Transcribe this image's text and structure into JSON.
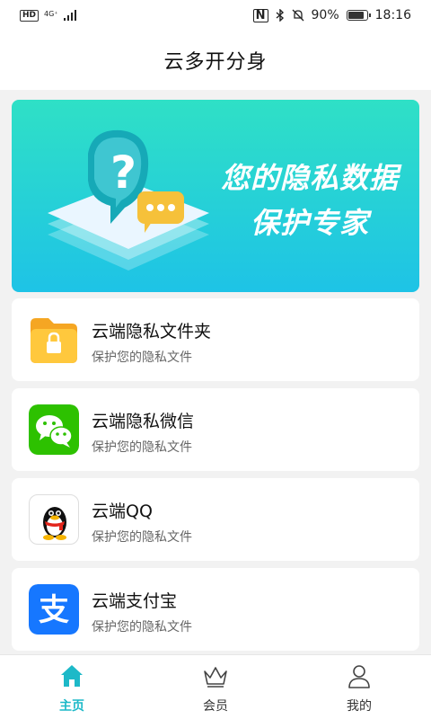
{
  "status_bar": {
    "hd": "HD",
    "network": "4G⁺",
    "nfc": "N",
    "battery_percent": "90%",
    "battery_level": 0.9,
    "time": "18:16"
  },
  "header": {
    "title": "云多开分身"
  },
  "banner": {
    "line1": "您的隐私数据",
    "line2": "保护专家",
    "gradient_top": "#2fe0c6",
    "gradient_bottom": "#1ec3e6"
  },
  "apps": [
    {
      "title": "云端隐私文件夹",
      "subtitle": "保护您的隐私文件",
      "icon": "folder-lock-icon"
    },
    {
      "title": "云端隐私微信",
      "subtitle": "保护您的隐私文件",
      "icon": "wechat-icon"
    },
    {
      "title": "云端QQ",
      "subtitle": "保护您的隐私文件",
      "icon": "qq-penguin-icon"
    },
    {
      "title": "云端支付宝",
      "subtitle": "保护您的隐私文件",
      "icon": "alipay-icon"
    }
  ],
  "tabbar": {
    "tabs": [
      {
        "label": "主页",
        "icon": "home-icon",
        "active": true
      },
      {
        "label": "会员",
        "icon": "crown-icon",
        "active": false
      },
      {
        "label": "我的",
        "icon": "user-icon",
        "active": false
      }
    ],
    "accent": "#1db9c8"
  }
}
